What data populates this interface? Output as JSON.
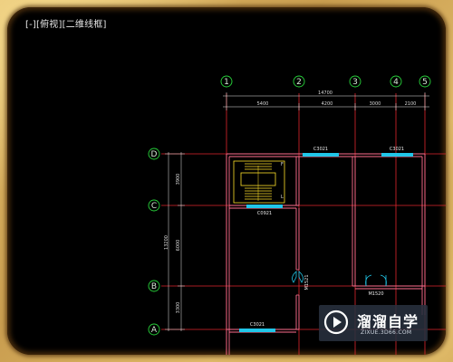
{
  "viewport": {
    "label": "[-][俯视][二维线框]"
  },
  "axes": {
    "vertical": [
      "1",
      "2",
      "3",
      "4",
      "5"
    ],
    "horizontal": [
      "D",
      "C",
      "B",
      "A"
    ]
  },
  "dimensions": {
    "total_top": "14700",
    "segments_top": [
      "5400",
      "4200",
      "3000",
      "2100"
    ],
    "total_left": "13200",
    "segments_left": [
      "3900",
      "6000",
      "3300"
    ]
  },
  "tags": {
    "window_top_1": "C3021",
    "window_top_2": "C3021",
    "window_stair": "C0921",
    "window_bottom": "C3021",
    "door_1": "M1521",
    "door_2": "M1520",
    "stair_up": "F",
    "stair_dn": "L"
  },
  "watermark": {
    "brand": "溜溜自学",
    "url": "ZIXUE.3D66.COM"
  },
  "colors": {
    "grid_line": "#e0262e",
    "axis_bubble": "#27d23a",
    "wall": "#ff6e8e",
    "window": "#21c6e8",
    "stair": "#ffe22a",
    "dim_line": "#e8e8e8",
    "background": "#000000"
  }
}
